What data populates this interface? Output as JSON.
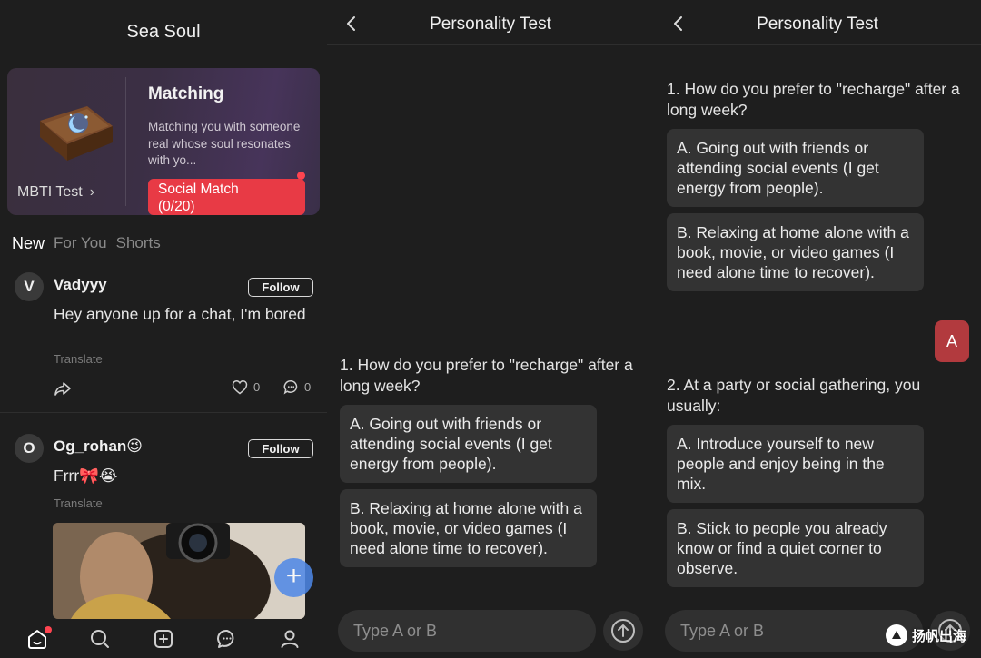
{
  "feed": {
    "title": "Sea Soul",
    "match_card": {
      "test_link": "MBTI Test",
      "title": "Matching",
      "description": "Matching you with someone real whose soul resonates with yo...",
      "button": "Social Match\n(0/20)"
    },
    "tabs": [
      "New",
      "For You",
      "Shorts"
    ],
    "posts": [
      {
        "avatar": "V",
        "username": "Vadyyy",
        "follow": "Follow",
        "text": "Hey anyone up for a chat, I'm bored",
        "translate": "Translate",
        "likes": "0",
        "comments": "0"
      },
      {
        "avatar": "O",
        "username": "Og_rohan😉",
        "follow": "Follow",
        "text": "Frrr🎀😭",
        "translate": "Translate"
      }
    ],
    "fab_icon": "plus-icon",
    "nav": [
      "home-icon",
      "search-icon",
      "add-post-icon",
      "chat-icon",
      "profile-icon"
    ]
  },
  "chat_a": {
    "title": "Personality Test",
    "q1": "1. How do you prefer to \"recharge\" after a long week?",
    "q1_a": "A. Going out with friends or attending social events (I get energy from people).",
    "q1_b": "B. Relaxing at home alone with a book, movie, or video games (I need alone time to recover).",
    "input_placeholder": "Type A or B"
  },
  "chat_b": {
    "title": "Personality Test",
    "q1": "1. How do you prefer to \"recharge\" after a long week?",
    "q1_a": "A. Going out with friends or attending social events (I get energy from people).",
    "q1_b": "B. Relaxing at home alone with a book, movie, or video games (I need alone time to recover).",
    "answer": "A",
    "q2": "2. At a party or social gathering, you usually:",
    "q2_a": "A. Introduce yourself to new people and enjoy being in the mix.",
    "q2_b": "B. Stick to people you already know or find a quiet corner to observe.",
    "input_placeholder": "Type A or B"
  },
  "watermark": "扬帆出海",
  "colors": {
    "accent": "#e83a45",
    "answer_bubble": "#b23a3e",
    "fab": "#4e88e8"
  }
}
